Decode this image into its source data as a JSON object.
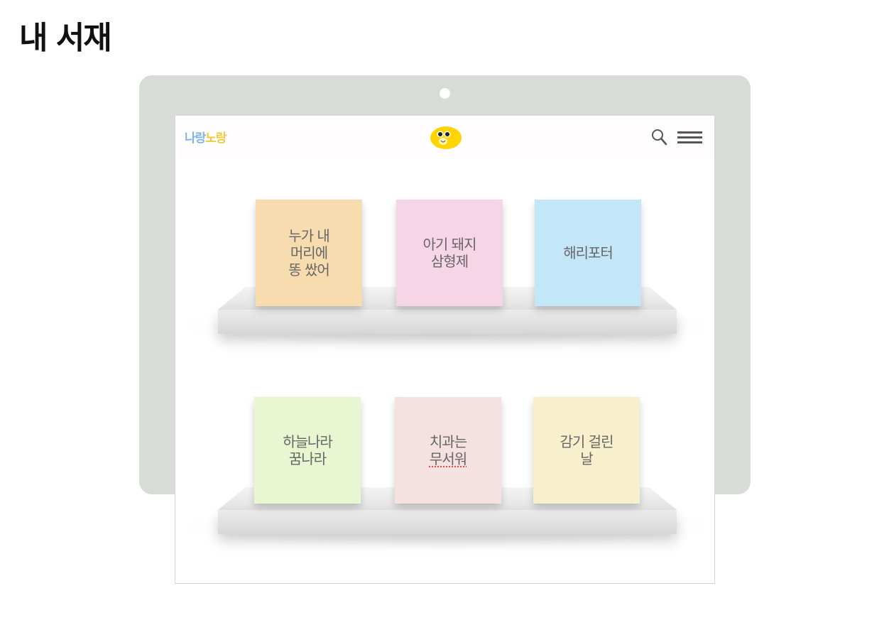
{
  "page": {
    "title": "내 서재"
  },
  "header": {
    "brand_part1": "나랑",
    "brand_part2": "노랑",
    "colors": {
      "brand_blue": "#7fb3e6",
      "brand_yellow": "#f2c83a",
      "mascot": "#ffd400"
    }
  },
  "icons": {
    "search": "search-icon",
    "menu": "hamburger-menu-icon",
    "mascot": "mascot-logo-icon"
  },
  "shelves": [
    {
      "books": [
        {
          "title": "누가 내\n머리에\n똥 쌌어",
          "color": "#f6dcaf"
        },
        {
          "title": "아기 돼지\n삼형제",
          "color": "#f6d5e7"
        },
        {
          "title": "해리포터",
          "color": "#c3e6f8"
        }
      ]
    },
    {
      "books": [
        {
          "title": "하늘나라\n꿈나라",
          "color": "#e8f6d1"
        },
        {
          "title": "치과는\n무서워",
          "color": "#f6e1e1"
        },
        {
          "title": "감기 걸린\n날",
          "color": "#f8efcc"
        }
      ]
    }
  ]
}
